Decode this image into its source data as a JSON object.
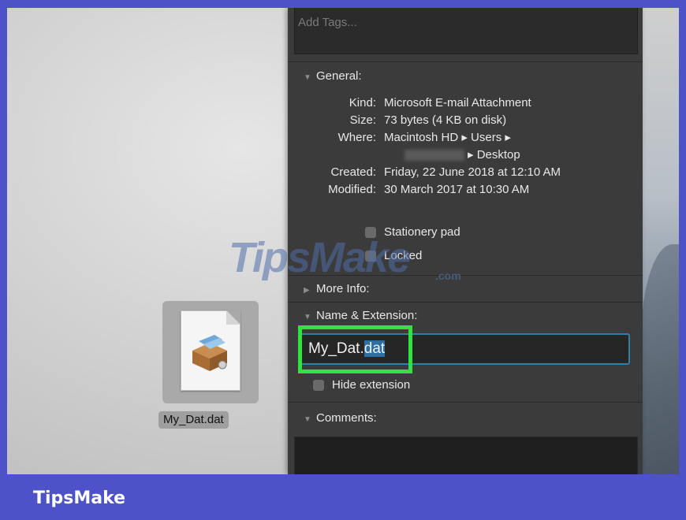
{
  "file": {
    "name": "My_Dat.dat",
    "icon": "mail-attachment-icon"
  },
  "tags": {
    "placeholder": "Add Tags..."
  },
  "general": {
    "header": "General:",
    "rows": [
      {
        "label": "Kind:",
        "value": "Microsoft E-mail Attachment"
      },
      {
        "label": "Size:",
        "value": "73 bytes (4 KB on disk)"
      },
      {
        "label": "Where:",
        "value": "Macintosh HD ▸ Users ▸"
      },
      {
        "label": "",
        "value": "▸ Desktop"
      },
      {
        "label": "Created:",
        "value": "Friday, 22 June 2018 at 12:10 AM"
      },
      {
        "label": "Modified:",
        "value": "30 March 2017 at 10:30 AM"
      }
    ],
    "stationery_label": "Stationery pad",
    "locked_label": "Locked"
  },
  "more_info": {
    "header": "More Info:"
  },
  "name_ext": {
    "header": "Name & Extension:",
    "name_base": "My_Dat.",
    "name_ext_selected": "dat",
    "hide_extension_label": "Hide extension"
  },
  "comments": {
    "header": "Comments:"
  },
  "watermark": {
    "text": "TipsMake",
    "suffix": ".com"
  },
  "footer": {
    "brand": "TipsMake"
  },
  "colors": {
    "frame": "#4d52c9",
    "highlight": "#2ce63c",
    "focus": "#2f7fa6",
    "panel": "#3b3b3b"
  }
}
